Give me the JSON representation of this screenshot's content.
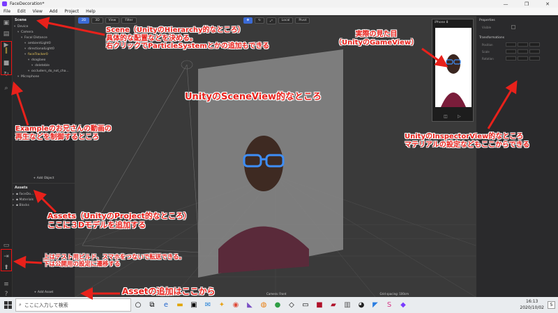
{
  "window": {
    "title": "FaceDecoration*",
    "controls": [
      "—",
      "❐",
      "✕"
    ]
  },
  "menu": [
    "File",
    "Edit",
    "View",
    "Add",
    "Project",
    "Help"
  ],
  "scene": {
    "title": "Scene",
    "items": [
      {
        "label": "Device",
        "depth": 0
      },
      {
        "label": "Camera",
        "depth": 1
      },
      {
        "label": "Focal Distance",
        "depth": 2
      },
      {
        "label": "ambientLight0",
        "depth": 3
      },
      {
        "label": "directionalLight0",
        "depth": 3
      },
      {
        "label": "faceTracker0",
        "depth": 3,
        "selected": true
      },
      {
        "label": "dsaglaeo",
        "depth": 4
      },
      {
        "label": "deleteble",
        "depth": 5
      },
      {
        "label": "occluders_do_not_cha...",
        "depth": 4
      },
      {
        "label": "Microphone",
        "depth": 1
      }
    ],
    "add_button": "+ Add Object"
  },
  "assets": {
    "title": "Assets",
    "items": [
      "FaceDo...",
      "Materials",
      "Blocks"
    ],
    "add_button": "+ Add Asset"
  },
  "viewport": {
    "toolbar": {
      "mode2d": "2D",
      "mode3d": "3D",
      "view": "View",
      "filter": "Filter",
      "local": "Local",
      "pivot": "Pivot"
    },
    "camera_label": "Camera: Front",
    "grid_spacing": "Grid spacing: 100cm"
  },
  "game_view": {
    "device": "iPhone 8"
  },
  "inspector": {
    "properties_title": "Properties",
    "visible_label": "Visible",
    "transformations_title": "Transformations",
    "rows": [
      "Position",
      "Scale",
      "Rotation"
    ]
  },
  "taskbar": {
    "search_placeholder": "ここに入力して検索",
    "time": "16:13",
    "date": "2020/10/02",
    "badge": "5"
  },
  "annotations": {
    "scene": [
      "Scene（UnityのHierarchy的なところ）",
      "具体的な配置などを決める。",
      "右クリックでParticleSystemとかの追加もできる"
    ],
    "game": [
      "実際の見た目",
      "（UnityのGameView）"
    ],
    "sceneview": "UnityのSceneView的なところ",
    "example": [
      "Exampleのお兄さんの動画の",
      "再生などを制御するところ"
    ],
    "inspector": [
      "UnityのInspectorView的なところ",
      "マテリアルの設定などもここからできる"
    ],
    "assets": [
      "Assets（UnityのProject的なところ）",
      "ここに３Dモデルを追加する"
    ],
    "build": [
      "上はテスト用ビルド、スマホをつないで転送できる。",
      "下は公開用の設定に遷移する"
    ],
    "add_asset": "Assetの追加はここから"
  },
  "colors": {
    "annotation": "#e8211b",
    "accent": "#3b6bd6",
    "selected": "#e7c65a"
  }
}
